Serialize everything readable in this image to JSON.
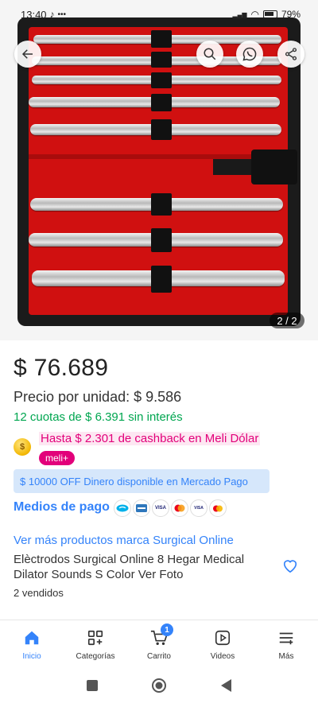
{
  "status_bar": {
    "time": "13:40",
    "battery": "79%"
  },
  "gallery": {
    "page_indicator": "2 / 2"
  },
  "product": {
    "price": "$ 76.689",
    "unit_price": "Precio por unidad: $ 9.586",
    "installments": "12 cuotas de $ 6.391 sin interés",
    "cashback": "Hasta $ 2.301 de cashback en Meli Dólar",
    "meli_badge": "meli+",
    "mp_banner": "$ 10000 OFF Dinero disponible en Mercado Pago",
    "payment_link": "Medios de pago",
    "brand_link": "Ver más productos marca Surgical Online",
    "title": "Elèctrodos Surgical Online 8 Hegar Medical Dilator Sounds S Color Ver Foto",
    "sold": "2 vendidos"
  },
  "payment_icons": [
    "mercado-pago-icon",
    "amex-icon",
    "visa-icon",
    "mastercard-icon",
    "visa-debit-icon",
    "maestro-icon"
  ],
  "bottom_nav": {
    "items": [
      {
        "label": "Inicio",
        "icon": "home-icon"
      },
      {
        "label": "Categorías",
        "icon": "categories-icon"
      },
      {
        "label": "Carrito",
        "icon": "cart-icon",
        "badge": "1"
      },
      {
        "label": "Videos",
        "icon": "play-icon"
      },
      {
        "label": "Más",
        "icon": "menu-icon"
      }
    ]
  },
  "colors": {
    "accent": "#3483fa",
    "green": "#00a650",
    "pink": "#e2007a"
  }
}
